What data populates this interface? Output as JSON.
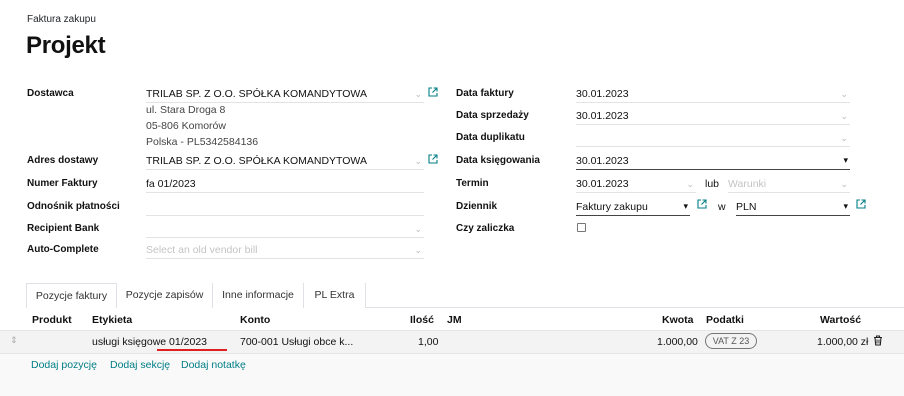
{
  "breadcrumb": "Faktura zakupu",
  "title": "Projekt",
  "left": {
    "vendor_label": "Dostawca",
    "vendor_value": "TRILAB SP. Z O.O. SPÓŁKA KOMANDYTOWA",
    "address_line1": "ul. Stara Droga 8",
    "address_line2": "05-806 Komorów",
    "address_line3": "Polska - PL5342584136",
    "delivery_label": "Adres dostawy",
    "delivery_value": "TRILAB SP. Z O.O. SPÓŁKA KOMANDYTOWA",
    "invoice_no_label": "Numer Faktury",
    "invoice_no_value": "fa 01/2023",
    "payment_ref_label": "Odnośnik płatności",
    "recipient_bank_label": "Recipient Bank",
    "auto_complete_label": "Auto-Complete",
    "auto_complete_placeholder": "Select an old vendor bill"
  },
  "right": {
    "invoice_date_label": "Data faktury",
    "invoice_date_value": "30.01.2023",
    "sale_date_label": "Data sprzedaży",
    "sale_date_value": "30.01.2023",
    "duplicate_date_label": "Data duplikatu",
    "accounting_date_label": "Data księgowania",
    "accounting_date_value": "30.01.2023",
    "term_label": "Termin",
    "term_value": "30.01.2023",
    "or_label": "lub",
    "terms_placeholder": "Warunki",
    "journal_label": "Dziennik",
    "journal_value": "Faktury zakupu",
    "in_label": "w",
    "currency_value": "PLN",
    "advance_label": "Czy zaliczka"
  },
  "tabs": [
    "Pozycje faktury",
    "Pozycje zapisów",
    "Inne informacje",
    "PL Extra"
  ],
  "table": {
    "headers": {
      "product": "Produkt",
      "label": "Etykieta",
      "account": "Konto",
      "quantity": "Ilość",
      "uom": "JM",
      "amount": "Kwota",
      "taxes": "Podatki",
      "value": "Wartość"
    },
    "rows": [
      {
        "label": "usługi księgowe 01/2023",
        "account": "700-001 Usługi obce k...",
        "quantity": "1,00",
        "amount": "1.000,00",
        "tax": "VAT Z 23",
        "value": "1.000,00 zł"
      }
    ]
  },
  "actions": {
    "add_line": "Dodaj pozycję",
    "add_section": "Dodaj sekcję",
    "add_note": "Dodaj notatkę"
  },
  "colors": {
    "accent": "#017e84",
    "annotation": "#e02020"
  }
}
